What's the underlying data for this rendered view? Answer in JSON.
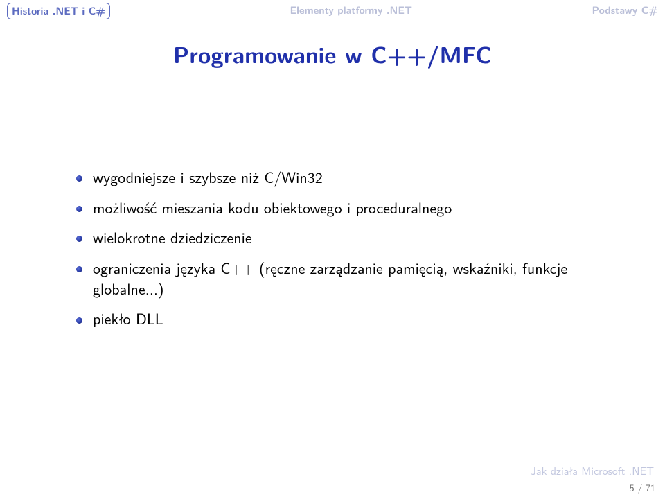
{
  "nav": {
    "left": "Historia .NET i C#",
    "center": "Elementy platformy .NET",
    "right": "Podstawy C#"
  },
  "title": "Programowanie w C++/MFC",
  "bullets": [
    "wygodniejsze i szybsze niż C/Win32",
    "możliwość mieszania kodu obiektowego i proceduralnego",
    "wielokrotne dziedziczenie",
    "ograniczenia języka C++ (ręczne zarządzanie pamięcią, wskaźniki, funkcje globalne...)",
    "piekło DLL"
  ],
  "footer": {
    "source": "Jak działa Microsoft .NET",
    "page": "5 / 71"
  }
}
